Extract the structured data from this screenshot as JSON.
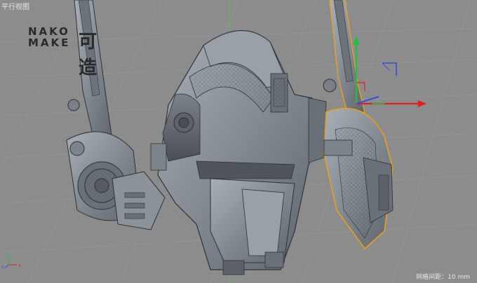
{
  "viewport": {
    "view_name": "平行视图",
    "grid_spacing": "网格间距：10 mm"
  },
  "brand": {
    "line1": "NAKO",
    "line2": "MAKE",
    "mark": "可造"
  },
  "axes": {
    "x_color": "#e02020",
    "y_color": "#20c040",
    "z_color": "#3050e0"
  },
  "selection_color": "#e8a020"
}
